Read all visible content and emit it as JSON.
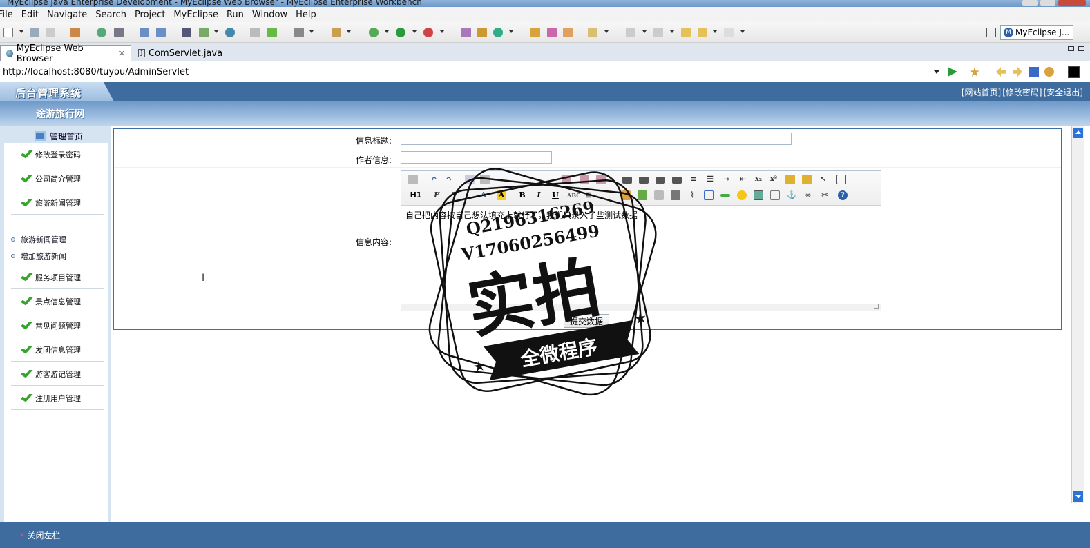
{
  "window": {
    "title": "MyEclipse Java Enterprise Development - MyEclipse Web Browser - MyEclipse Enterprise Workbench"
  },
  "menu": [
    "File",
    "Edit",
    "Navigate",
    "Search",
    "Project",
    "MyEclipse",
    "Run",
    "Window",
    "Help"
  ],
  "perspective": {
    "label": "MyEclipse J..."
  },
  "tabs": [
    {
      "label": "MyEclipse Web Browser",
      "active": true,
      "close": "✕"
    },
    {
      "label": "ComServlet.java",
      "active": false
    }
  ],
  "browser": {
    "url": "http://localhost:8080/tuyou/AdminServlet"
  },
  "app": {
    "system_title": "后台管理系统",
    "site_name": "途游旅行网",
    "header_links": [
      "[网站首页]",
      "[修改密码]",
      "[安全退出]"
    ]
  },
  "sidebar": {
    "home": "管理首页",
    "items": [
      "修改登录密码",
      "公司简介管理",
      "旅游新闻管理",
      "服务项目管理",
      "景点信息管理",
      "常见问题管理",
      "发团信息管理",
      "游客游记管理",
      "注册用户管理"
    ],
    "sub_items": [
      "旅游新闻管理",
      "增加旅游新闻"
    ]
  },
  "form": {
    "title_label": "信息标题:",
    "title_value": "",
    "author_label": "作者信息:",
    "author_value": "",
    "content_label": "信息内容:",
    "content_value": "自己把内容按自己想法填充上就行了，我们只录入了些测试数据",
    "editor_heading_button": "H1",
    "submit_label": "提交数据"
  },
  "footer": {
    "close_sidebar": "关闭左栏",
    "close_mark": "✕"
  },
  "watermark": {
    "line1": "Q2196316269",
    "line2": "V17060256499",
    "big_text": "实拍",
    "banner_text": "全微程序"
  }
}
